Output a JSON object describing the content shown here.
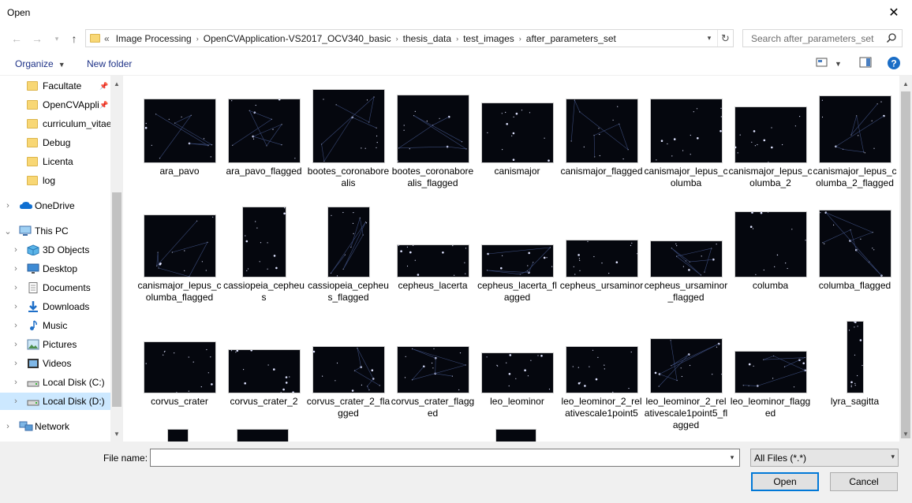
{
  "window": {
    "title": "Open"
  },
  "address": {
    "overflow": "«",
    "crumbs": [
      "Image Processing",
      "OpenCVApplication-VS2017_OCV340_basic",
      "thesis_data",
      "test_images",
      "after_parameters_set"
    ]
  },
  "search": {
    "placeholder": "Search after_parameters_set"
  },
  "toolbar": {
    "organize": "Organize",
    "new_folder": "New folder"
  },
  "sidebar": {
    "items": [
      {
        "label": "Facultate",
        "icon": "folder-icon",
        "pinned": true
      },
      {
        "label": "OpenCVAppli",
        "icon": "folder-icon",
        "pinned": true
      },
      {
        "label": "curriculum_vitae",
        "icon": "folder-icon"
      },
      {
        "label": "Debug",
        "icon": "folder-icon"
      },
      {
        "label": "Licenta",
        "icon": "folder-icon"
      },
      {
        "label": "log",
        "icon": "folder-icon"
      },
      {
        "label": "OneDrive",
        "icon": "cloud-icon"
      },
      {
        "label": "This PC",
        "icon": "computer-icon"
      },
      {
        "label": "3D Objects",
        "icon": "cube-icon"
      },
      {
        "label": "Desktop",
        "icon": "desktop-icon"
      },
      {
        "label": "Documents",
        "icon": "document-icon"
      },
      {
        "label": "Downloads",
        "icon": "download-icon"
      },
      {
        "label": "Music",
        "icon": "music-icon"
      },
      {
        "label": "Pictures",
        "icon": "picture-icon"
      },
      {
        "label": "Videos",
        "icon": "video-icon"
      },
      {
        "label": "Local Disk (C:)",
        "icon": "drive-icon"
      },
      {
        "label": "Local Disk (D:)",
        "icon": "drive-icon",
        "selected": true
      },
      {
        "label": "Network",
        "icon": "network-icon"
      }
    ]
  },
  "files": [
    {
      "name": "ara_pavo"
    },
    {
      "name": "ara_pavo_flagged"
    },
    {
      "name": "bootes_coronaborealis"
    },
    {
      "name": "bootes_coronaborealis_flagged"
    },
    {
      "name": "canismajor"
    },
    {
      "name": "canismajor_flagged"
    },
    {
      "name": "canismajor_lepus_columba"
    },
    {
      "name": "canismajor_lepus_columba_2"
    },
    {
      "name": "canismajor_lepus_columba_2_flagged"
    },
    {
      "name": "canismajor_lepus_columba_flagged"
    },
    {
      "name": "cassiopeia_cepheus"
    },
    {
      "name": "cassiopeia_cepheus_flagged"
    },
    {
      "name": "cepheus_lacerta"
    },
    {
      "name": "cepheus_lacerta_flagged"
    },
    {
      "name": "cepheus_ursaminor"
    },
    {
      "name": "cepheus_ursaminor_flagged"
    },
    {
      "name": "columba"
    },
    {
      "name": "columba_flagged"
    },
    {
      "name": "corvus_crater"
    },
    {
      "name": "corvus_crater_2"
    },
    {
      "name": "corvus_crater_2_flagged"
    },
    {
      "name": "corvus_crater_flagged"
    },
    {
      "name": "leo_leominor"
    },
    {
      "name": "leo_leominor_2_relativescale1point5"
    },
    {
      "name": "leo_leominor_2_relativescale1point5_flagged"
    },
    {
      "name": "leo_leominor_flagged"
    },
    {
      "name": "lyra_sagitta"
    }
  ],
  "bottom": {
    "file_name_label": "File name:",
    "file_name_value": "",
    "file_type": "All Files (*.*)",
    "open_label": "Open",
    "cancel_label": "Cancel"
  }
}
